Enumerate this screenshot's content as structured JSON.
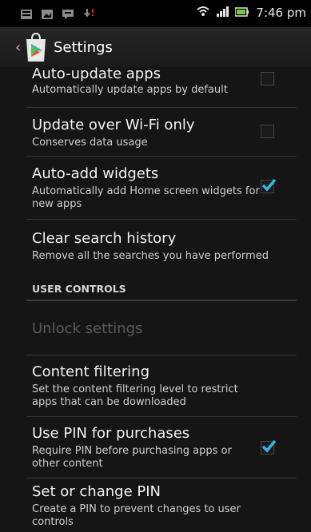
{
  "status_bar": {
    "time": "7:46 pm"
  },
  "action_bar": {
    "title": "Settings",
    "icon": "play-store-icon"
  },
  "settings": {
    "items": [
      {
        "title": "Auto-update apps",
        "summary": "Automatically update apps by default",
        "checked": false
      },
      {
        "title": "Update over Wi-Fi only",
        "summary": "Conserves data usage",
        "checked": false
      },
      {
        "title": "Auto-add widgets",
        "summary": "Automatically add Home screen widgets for new apps",
        "checked": true
      },
      {
        "title": "Clear search history",
        "summary": "Remove all the searches you have performed"
      }
    ],
    "section_header": "USER CONTROLS",
    "user_controls": [
      {
        "title": "Unlock settings",
        "enabled": false
      },
      {
        "title": "Content filtering",
        "summary": "Set the content filtering level to restrict apps that can be downloaded"
      },
      {
        "title": "Use PIN for purchases",
        "summary": "Require PIN before purchasing apps or other content",
        "checked": true
      },
      {
        "title": "Set or change PIN",
        "summary": "Create a PIN to prevent changes to user controls"
      }
    ]
  },
  "colors": {
    "checkmark": "#33b5e5",
    "background": "#151515",
    "action_bar": "#222222"
  }
}
